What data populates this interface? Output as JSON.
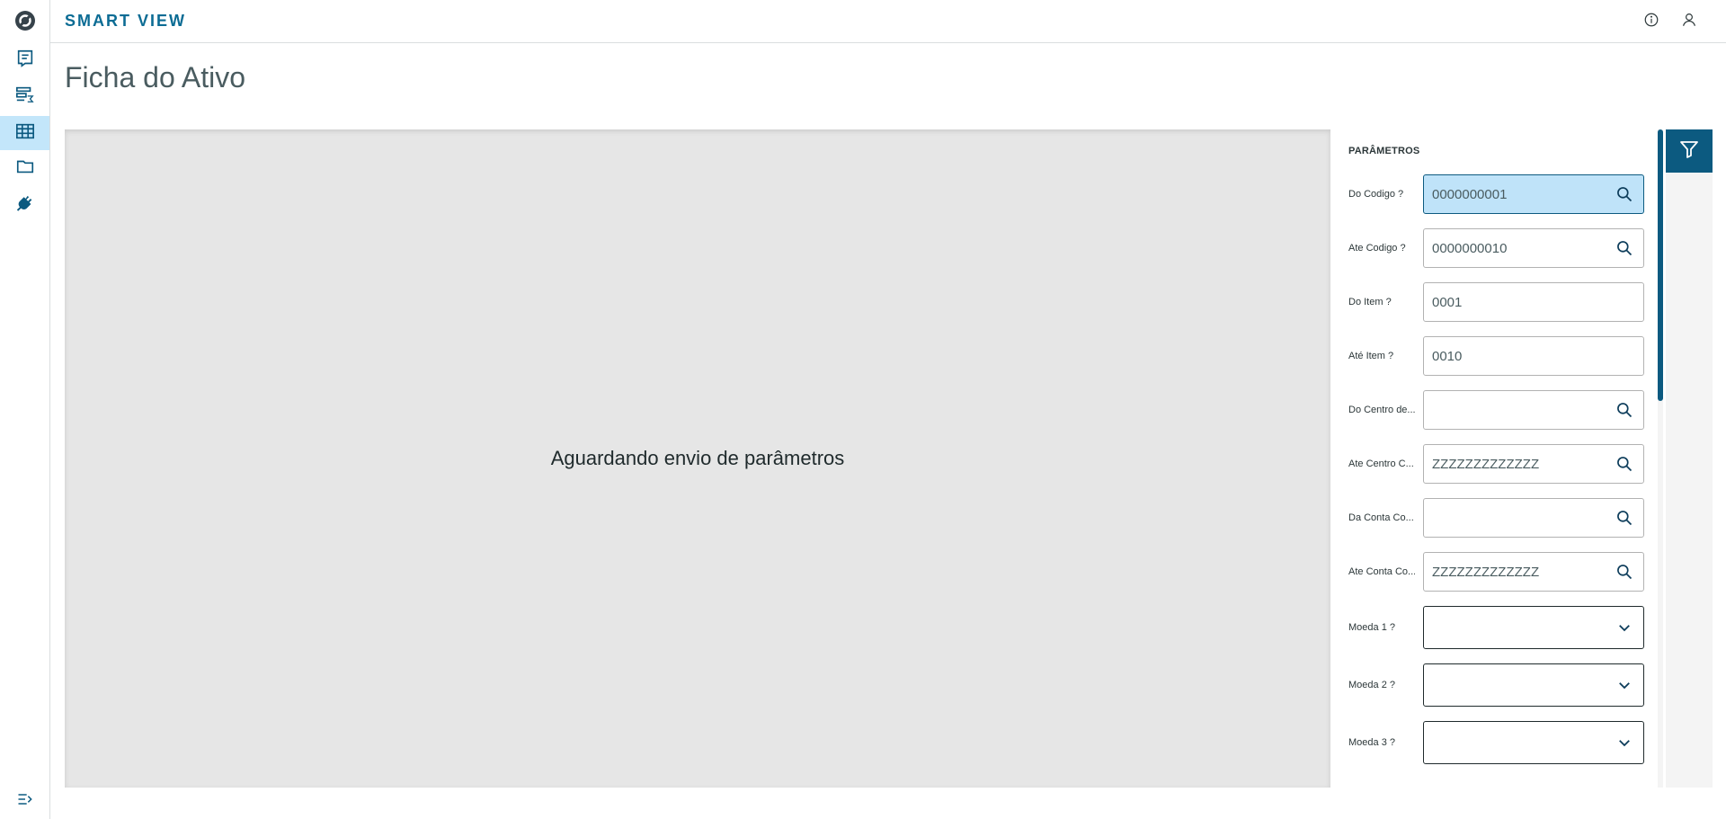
{
  "header": {
    "app_title": "SMART VIEW"
  },
  "page": {
    "title": "Ficha do Ativo"
  },
  "content": {
    "waiting_message": "Aguardando envio de parâmetros"
  },
  "params": {
    "title": "PARÂMETROS",
    "fields": [
      {
        "label": "Do Codigo ?",
        "value": "0000000001",
        "type": "lookup",
        "focused": true
      },
      {
        "label": "Ate Codigo ?",
        "value": "0000000010",
        "type": "lookup"
      },
      {
        "label": "Do Item ?",
        "value": "0001",
        "type": "text"
      },
      {
        "label": "Até Item ?",
        "value": "0010",
        "type": "text"
      },
      {
        "label": "Do Centro de...",
        "value": "",
        "type": "lookup"
      },
      {
        "label": "Ate Centro C...",
        "value": "ZZZZZZZZZZZZZ",
        "type": "lookup"
      },
      {
        "label": "Da Conta Co...",
        "value": "",
        "type": "lookup"
      },
      {
        "label": "Ate Conta Co...",
        "value": "ZZZZZZZZZZZZZ",
        "type": "lookup"
      },
      {
        "label": "Moeda 1 ?",
        "value": "",
        "type": "select"
      },
      {
        "label": "Moeda 2 ?",
        "value": "",
        "type": "select"
      },
      {
        "label": "Moeda 3 ?",
        "value": "",
        "type": "select"
      }
    ]
  },
  "sidebar": {
    "items": [
      {
        "icon": "report-icon",
        "active": false
      },
      {
        "icon": "data-sum-icon",
        "active": false
      },
      {
        "icon": "table-icon",
        "active": true
      },
      {
        "icon": "folder-icon",
        "active": false
      },
      {
        "icon": "plug-icon",
        "active": false
      }
    ]
  },
  "colors": {
    "brand": "#0c6c94",
    "primary_dark": "#0c5a80",
    "active_bg": "#c3e6fa",
    "focused_field": "#bfe3f9"
  }
}
